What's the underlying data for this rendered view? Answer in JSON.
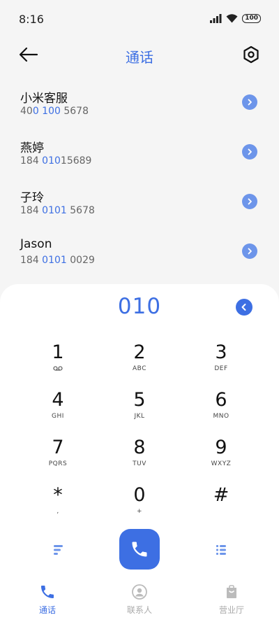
{
  "status": {
    "time": "8:16",
    "battery": "100"
  },
  "header": {
    "title": "通话"
  },
  "contacts": [
    {
      "name": "小米客服",
      "number_pre": "40",
      "number_hl": "0 100",
      "number_post": " 5678"
    },
    {
      "name": "燕婷",
      "number_pre": "184 ",
      "number_hl": "010",
      "number_post": "15689"
    },
    {
      "name": "子玲",
      "number_pre": "184 ",
      "number_hl": "0101",
      "number_post": " 5678"
    },
    {
      "name": "Jason",
      "number_pre": "184 ",
      "number_hl": "0101",
      "number_post": " 0029"
    }
  ],
  "dialer": {
    "display": "010"
  },
  "keypad": [
    {
      "digit": "1",
      "letters": ""
    },
    {
      "digit": "2",
      "letters": "ABC"
    },
    {
      "digit": "3",
      "letters": "DEF"
    },
    {
      "digit": "4",
      "letters": "GHI"
    },
    {
      "digit": "5",
      "letters": "JKL"
    },
    {
      "digit": "6",
      "letters": "MNO"
    },
    {
      "digit": "7",
      "letters": "PQRS"
    },
    {
      "digit": "8",
      "letters": "TUV"
    },
    {
      "digit": "9",
      "letters": "WXYZ"
    },
    {
      "digit": "*",
      "letters": ","
    },
    {
      "digit": "0",
      "letters": "+"
    },
    {
      "digit": "#",
      "letters": ""
    }
  ],
  "nav": [
    {
      "label": "通话",
      "icon": "phone-icon",
      "active": true
    },
    {
      "label": "联系人",
      "icon": "person-icon",
      "active": false
    },
    {
      "label": "营业厅",
      "icon": "bag-icon",
      "active": false
    }
  ],
  "colors": {
    "accent": "#3d6fe3",
    "arrow": "#6d95ea"
  }
}
